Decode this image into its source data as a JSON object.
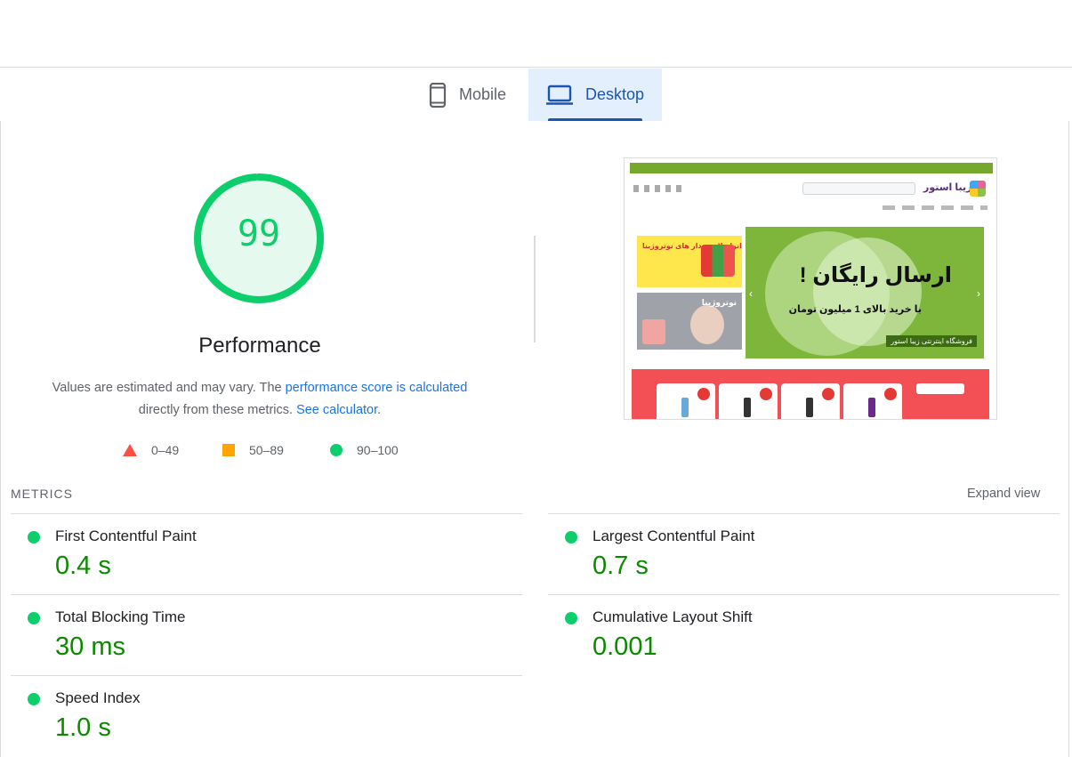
{
  "tabs": {
    "mobile": {
      "label": "Mobile",
      "icon": "smartphone-icon"
    },
    "desktop": {
      "label": "Desktop",
      "icon": "laptop-icon",
      "selected": true
    }
  },
  "performance": {
    "score": "99",
    "score_fraction": 0.99,
    "title": "Performance",
    "desc_1": "Values are estimated and may vary. The ",
    "desc_link_1": "performance score is calculated",
    "desc_2": "directly from these metrics. ",
    "desc_link_2": "See calculator",
    "desc_3": "."
  },
  "legend": [
    {
      "range": "0–49",
      "shape": "triangle",
      "color": "#ff4e42"
    },
    {
      "range": "50–89",
      "shape": "square",
      "color": "#ffa400"
    },
    {
      "range": "90–100",
      "shape": "circle",
      "color": "#0cce6b"
    }
  ],
  "screenshot": {
    "logo_text": "زیبا استور",
    "banner_title": "ارسال رایگان !",
    "banner_subtitle": "با خرید بالای 1 میلیون تومان",
    "banner_tag": "فروشگاه اینترنتی زیبا استور",
    "side_ad_1": "انواع لایه بردار های نوتروژینا",
    "side_ad_2": "نوتروژینا"
  },
  "metrics": {
    "section_label": "METRICS",
    "expand_label": "Expand view",
    "items": [
      {
        "name": "First Contentful Paint",
        "value": "0.4 s",
        "status_color": "#0cce6b"
      },
      {
        "name": "Largest Contentful Paint",
        "value": "0.7 s",
        "status_color": "#0cce6b"
      },
      {
        "name": "Total Blocking Time",
        "value": "30 ms",
        "status_color": "#0cce6b"
      },
      {
        "name": "Cumulative Layout Shift",
        "value": "0.001",
        "status_color": "#0cce6b"
      },
      {
        "name": "Speed Index",
        "value": "1.0 s",
        "status_color": "#0cce6b"
      }
    ]
  },
  "colors": {
    "pass": "#0cce6b",
    "pass_text": "#0b8a00",
    "accent": "#1a56b0",
    "link": "#1a73e8"
  }
}
